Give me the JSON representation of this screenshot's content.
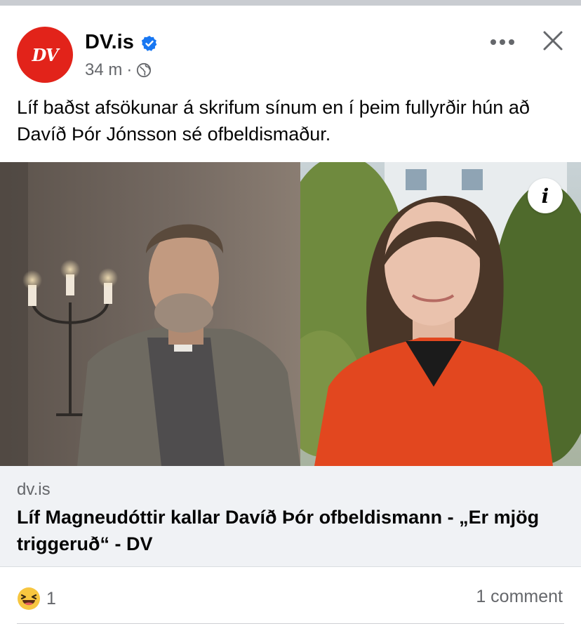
{
  "post": {
    "page_name": "DV.is",
    "avatar_text": "DV",
    "timestamp": "34 m",
    "separator": "·",
    "text": "Líf baðst afsökunar á skrifum sínum en í þeim fullyrðir hún að Davíð Þór Jónsson sé ofbeldismaður."
  },
  "link": {
    "domain": "dv.is",
    "title": "Líf Magneudóttir kallar Davíð Þór ofbeldismann - „Er mjög triggeruð“ - DV"
  },
  "footer": {
    "reaction_count": "1",
    "comment_count": "1 comment"
  },
  "icons": {
    "verified": "verified-badge-icon",
    "audience": "globe-icon",
    "more": "more-options-icon",
    "close": "close-icon",
    "info": "info-icon",
    "reaction": "haha-reaction-icon"
  },
  "colors": {
    "brand": "#e2231a",
    "verified": "#1877f2",
    "secondary_text": "#65676b",
    "card_bg": "#f0f2f5"
  }
}
